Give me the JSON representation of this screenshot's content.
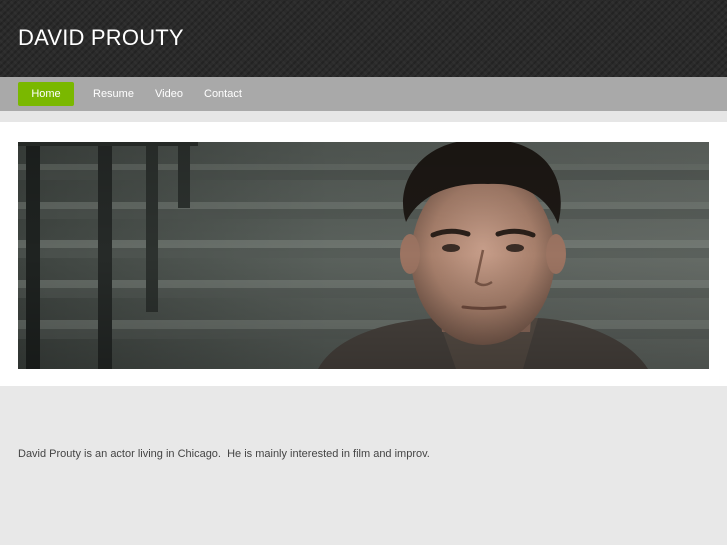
{
  "site": {
    "title": "DAVID PROUTY"
  },
  "nav": {
    "items": [
      {
        "label": "Home",
        "active": true
      },
      {
        "label": "Resume",
        "active": false
      },
      {
        "label": "Video",
        "active": false
      },
      {
        "label": "Contact",
        "active": false
      }
    ]
  },
  "content": {
    "bio": "David Prouty is an actor living in Chicago.  He is mainly interested in film and improv."
  },
  "colors": {
    "header_bg": "#2b2b2b",
    "nav_bg": "#a9a9a9",
    "nav_active": "#7ab800",
    "page_bg": "#e8e8e8",
    "text": "#444444"
  }
}
